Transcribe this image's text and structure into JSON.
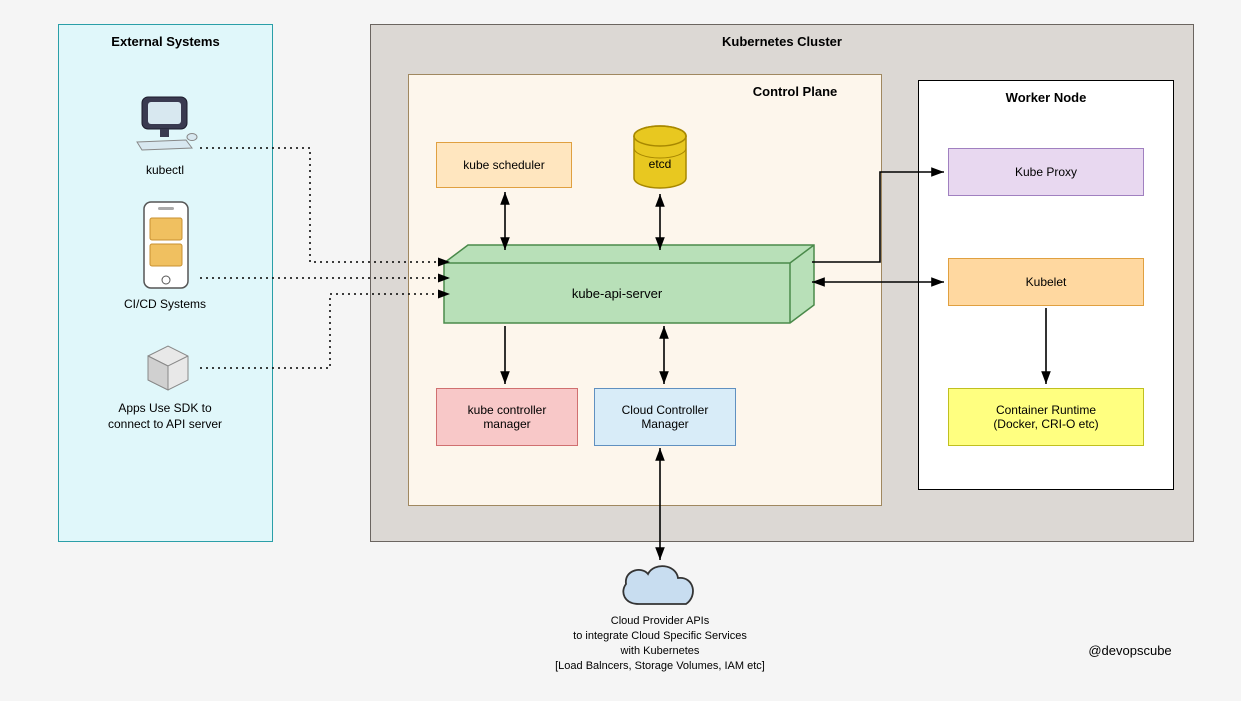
{
  "external": {
    "title": "External Systems",
    "kubectl": "kubectl",
    "cicd": "CI/CD Systems",
    "apps": "Apps Use SDK to\nconnect to API server"
  },
  "cluster": {
    "title": "Kubernetes Cluster",
    "controlPlane": {
      "title": "Control Plane",
      "scheduler": "kube scheduler",
      "etcd": "etcd",
      "apiServer": "kube-api-server",
      "kcm": "kube controller\nmanager",
      "ccm": "Cloud Controller\nManager"
    },
    "workerNode": {
      "title": "Worker Node",
      "kubeProxy": "Kube Proxy",
      "kubelet": "Kubelet",
      "runtime": "Container Runtime\n(Docker, CRI-O etc)"
    }
  },
  "cloud": {
    "l1": "Cloud Provider APIs",
    "l2": "to integrate Cloud Specific Services",
    "l3": "with Kubernetes",
    "l4": "[Load Balncers, Storage Volumes, IAM etc]"
  },
  "attribution": "@devopscube"
}
